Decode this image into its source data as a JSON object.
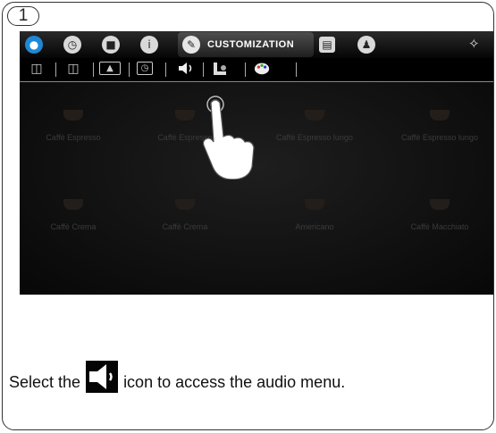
{
  "step": {
    "number": "1"
  },
  "toolbar": {
    "tabs": [
      {
        "icon": "water-drop-icon"
      },
      {
        "icon": "clock-icon"
      },
      {
        "icon": "cup-icon"
      },
      {
        "icon": "info-icon"
      }
    ],
    "active_tab": {
      "icon": "pencil-icon",
      "label": "CUSTOMIZATION"
    },
    "after_tabs": [
      {
        "icon": "display-icon"
      },
      {
        "icon": "user-icon"
      }
    ],
    "settings_icon": "wrench-icon"
  },
  "subtoolbar": {
    "items": [
      {
        "icon": "book-icon"
      },
      {
        "icon": "book-open-icon"
      },
      {
        "icon": "screensaver-icon"
      },
      {
        "icon": "timer-icon"
      },
      {
        "icon": "speaker-icon"
      },
      {
        "icon": "cup-image-icon"
      },
      {
        "icon": "palette-icon"
      }
    ]
  },
  "drinks": [
    {
      "name": "Caffè Espresso"
    },
    {
      "name": "Caffè Espresso"
    },
    {
      "name": "Caffè Espresso lungo"
    },
    {
      "name": "Caffè Espresso lungo"
    },
    {
      "name": "Caffè Crema"
    },
    {
      "name": "Caffè Crema"
    },
    {
      "name": "Americano"
    },
    {
      "name": "Caffè Macchiato"
    }
  ],
  "caption": {
    "before": "Select the",
    "icon": "speaker-icon",
    "after": "icon to access the audio menu."
  },
  "colors": {
    "accent_blue": "#1e88d6",
    "screen_bg": "#0d0d0d",
    "frame": "#333333"
  }
}
